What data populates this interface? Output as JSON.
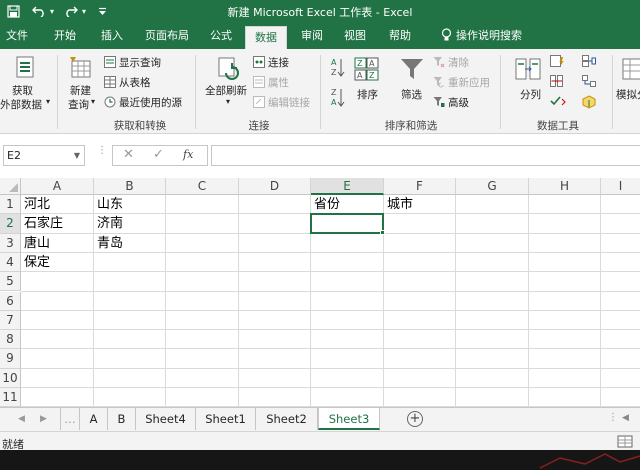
{
  "window": {
    "title": "新建 Microsoft Excel 工作表  -  Excel",
    "qat": [
      {
        "name": "save-icon",
        "glyph": "🖫"
      },
      {
        "name": "undo-icon",
        "glyph": "↶"
      },
      {
        "name": "undo-dropdown-icon",
        "glyph": "▾"
      },
      {
        "name": "redo-icon",
        "glyph": "↷"
      },
      {
        "name": "redo-dropdown-icon",
        "glyph": "▾"
      },
      {
        "name": "customize-qat-icon",
        "glyph": "⩡"
      }
    ]
  },
  "tabs": [
    "文件",
    "开始",
    "插入",
    "页面布局",
    "公式",
    "数据",
    "审阅",
    "视图",
    "帮助",
    "操作说明搜索"
  ],
  "active_tab": "数据",
  "ribbon": {
    "get_data": {
      "line1": "获取",
      "line2": "外部数据"
    },
    "new_query": {
      "line1": "新建",
      "line2": "查询"
    },
    "show_queries": "显示查询",
    "from_table": "从表格",
    "recent_sources": "最近使用的源",
    "group_transform": "获取和转换",
    "refresh_all": "全部刷新",
    "connections": "连接",
    "properties": "属性",
    "edit_links": "编辑链接",
    "group_connections": "连接",
    "sort": "排序",
    "filter": "筛选",
    "clear": "清除",
    "reapply": "重新应用",
    "advanced": "高级",
    "group_sort_filter": "排序和筛选",
    "text_to_columns": "分列",
    "group_data_tools": "数据工具",
    "what_if": "模拟分"
  },
  "formula_bar": {
    "name_box": "E2",
    "fx": "fx",
    "value": ""
  },
  "grid": {
    "columns": [
      "A",
      "B",
      "C",
      "D",
      "E",
      "F",
      "G",
      "H",
      "I"
    ],
    "rows": [
      "1",
      "2",
      "3",
      "4",
      "5",
      "6",
      "7",
      "8",
      "9",
      "10",
      "11"
    ],
    "selected_column": "E",
    "selected_row": "2",
    "cells": {
      "A1": "河北",
      "B1": "山东",
      "E1": "省份",
      "F1": "城市",
      "A2": "石家庄",
      "B2": "济南",
      "A3": "唐山",
      "B3": "青岛",
      "A4": "保定"
    }
  },
  "sheets": [
    "A",
    "B",
    "Sheet4",
    "Sheet1",
    "Sheet2",
    "Sheet3"
  ],
  "active_sheet": "Sheet3",
  "status": "就绪",
  "colors": {
    "accent": "#217346",
    "ribbon_bg": "#f3f3f3",
    "grid_line": "#dadada"
  }
}
